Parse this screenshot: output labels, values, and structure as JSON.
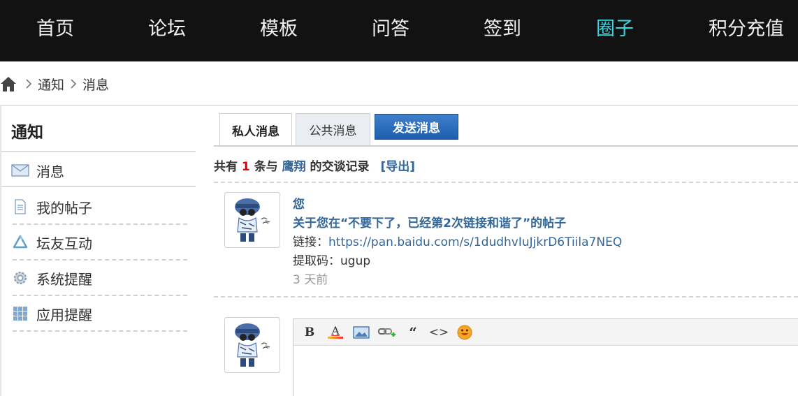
{
  "nav": {
    "items": [
      {
        "label": "首页",
        "active": false
      },
      {
        "label": "论坛",
        "active": false
      },
      {
        "label": "模板",
        "active": false
      },
      {
        "label": "问答",
        "active": false
      },
      {
        "label": "签到",
        "active": false
      },
      {
        "label": "圈子",
        "active": true
      },
      {
        "label": "积分充值",
        "active": false
      }
    ],
    "active_color": "#36d6e0"
  },
  "breadcrumb": {
    "icon": "home-icon",
    "items": [
      "通知",
      "消息"
    ]
  },
  "sidebar": {
    "title": "通知",
    "items": [
      {
        "label": "消息",
        "icon": "envelope-icon"
      },
      {
        "label": "我的帖子",
        "icon": "document-icon"
      },
      {
        "label": "坛友互动",
        "icon": "recycle-icon"
      },
      {
        "label": "系统提醒",
        "icon": "gear-icon"
      },
      {
        "label": "应用提醒",
        "icon": "grid-icon"
      }
    ]
  },
  "tabs": {
    "private": "私人消息",
    "public": "公共消息",
    "send": "发送消息"
  },
  "summary": {
    "prefix": "共有",
    "count": "1",
    "middle": "条与",
    "user": "鹰翔",
    "suffix": "的交谈记录",
    "export": "[导出]"
  },
  "message": {
    "author": "您",
    "subject": "关于您在“不要下了，已经第2次链接和谐了”的帖子",
    "link_label": "链接：",
    "link_url": "https://pan.baidu.com/s/1dudhvIuJjkrD6Tiila7NEQ",
    "code_label": "提取码：ugup",
    "time": "3 天前"
  },
  "editor": {
    "tools": [
      "bold-icon",
      "font-color-icon",
      "image-icon",
      "link-icon",
      "quote-icon",
      "code-icon",
      "emoji-icon"
    ],
    "bold_glyph": "B",
    "font_glyph": "A",
    "quote_glyph": "“",
    "code_glyph": "<>"
  }
}
